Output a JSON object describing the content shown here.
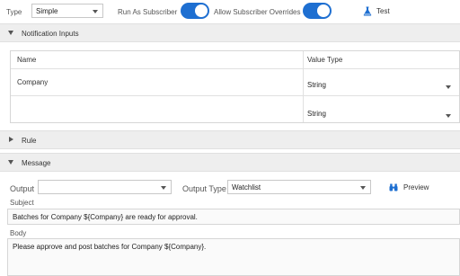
{
  "toolbar": {
    "type_label": "Type",
    "type_value": "Simple",
    "run_as_subscriber_label": "Run As Subscriber",
    "run_as_subscriber_on": true,
    "allow_overrides_label": "Allow Subscriber Overrides",
    "allow_overrides_on": true,
    "test_label": "Test"
  },
  "notification_inputs": {
    "section_title": "Notification Inputs",
    "columns": [
      "Name",
      "Value Type"
    ],
    "rows": [
      {
        "name": "Company",
        "value_type": "String"
      },
      {
        "name": "",
        "value_type": "String"
      }
    ]
  },
  "rule": {
    "section_title": "Rule"
  },
  "message": {
    "section_title": "Message",
    "output_label": "Output",
    "output_value": "",
    "output_type_label": "Output Type",
    "output_type_value": "Watchlist",
    "preview_label": "Preview",
    "subject_label": "Subject",
    "subject_value": "Batches for Company ${Company} are ready for approval.",
    "body_label": "Body",
    "body_value": "Please approve and post batches for Company ${Company}."
  },
  "colors": {
    "accent": "#1e6fd1",
    "section_bg": "#eeeeee"
  }
}
